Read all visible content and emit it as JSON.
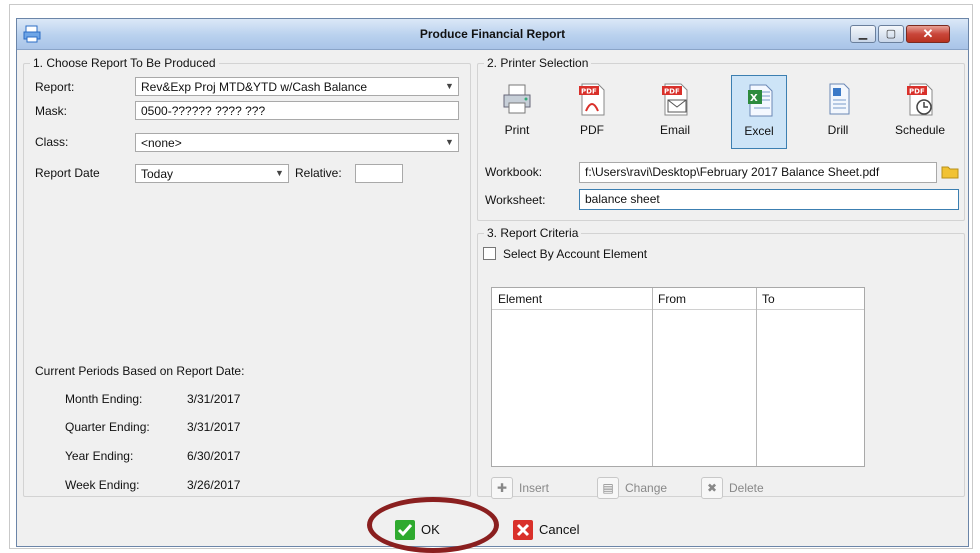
{
  "window": {
    "title": "Produce Financial Report",
    "min_glyph": "▁",
    "max_glyph": "▢",
    "close_glyph": "✕"
  },
  "section1": {
    "legend": "1. Choose Report To Be Produced",
    "report_label": "Report:",
    "report_value": "Rev&Exp Proj MTD&YTD w/Cash Balance",
    "mask_label": "Mask:",
    "mask_value": "0500-?????? ???? ???",
    "class_label": "Class:",
    "class_value": "<none>",
    "report_date_label": "Report Date",
    "report_date_value": "Today",
    "relative_label": "Relative:",
    "relative_value": "",
    "periods_heading": "Current Periods Based on Report Date:",
    "periods": [
      {
        "label": "Month Ending:",
        "value": "3/31/2017"
      },
      {
        "label": "Quarter Ending:",
        "value": "3/31/2017"
      },
      {
        "label": "Year Ending:",
        "value": "6/30/2017"
      },
      {
        "label": "Week Ending:",
        "value": "3/26/2017"
      }
    ]
  },
  "section2": {
    "legend": "2. Printer Selection",
    "tools": [
      {
        "label": "Print",
        "icon": "printer-icon"
      },
      {
        "label": "PDF",
        "icon": "pdf-icon"
      },
      {
        "label": "Email",
        "icon": "email-pdf-icon"
      },
      {
        "label": "Excel",
        "icon": "excel-icon",
        "selected": true
      },
      {
        "label": "Drill",
        "icon": "document-icon"
      },
      {
        "label": "Schedule",
        "icon": "schedule-pdf-icon"
      }
    ],
    "workbook_label": "Workbook:",
    "workbook_value": "f:\\Users\\ravi\\Desktop\\February 2017 Balance Sheet.pdf",
    "worksheet_label": "Worksheet:",
    "worksheet_value": "balance sheet"
  },
  "section3": {
    "legend": "3. Report Criteria",
    "select_by_label": "Select By Account Element",
    "select_by_checked": false,
    "columns": [
      "Element",
      "From",
      "To"
    ],
    "insert_label": "Insert",
    "change_label": "Change",
    "delete_label": "Delete"
  },
  "buttons": {
    "ok_label": "OK",
    "cancel_label": "Cancel"
  },
  "colors": {
    "accent": "#3c7fb1",
    "ok_green": "#2faa2f",
    "cancel_red": "#d9302a",
    "highlight_ring": "#8a1f1f"
  }
}
